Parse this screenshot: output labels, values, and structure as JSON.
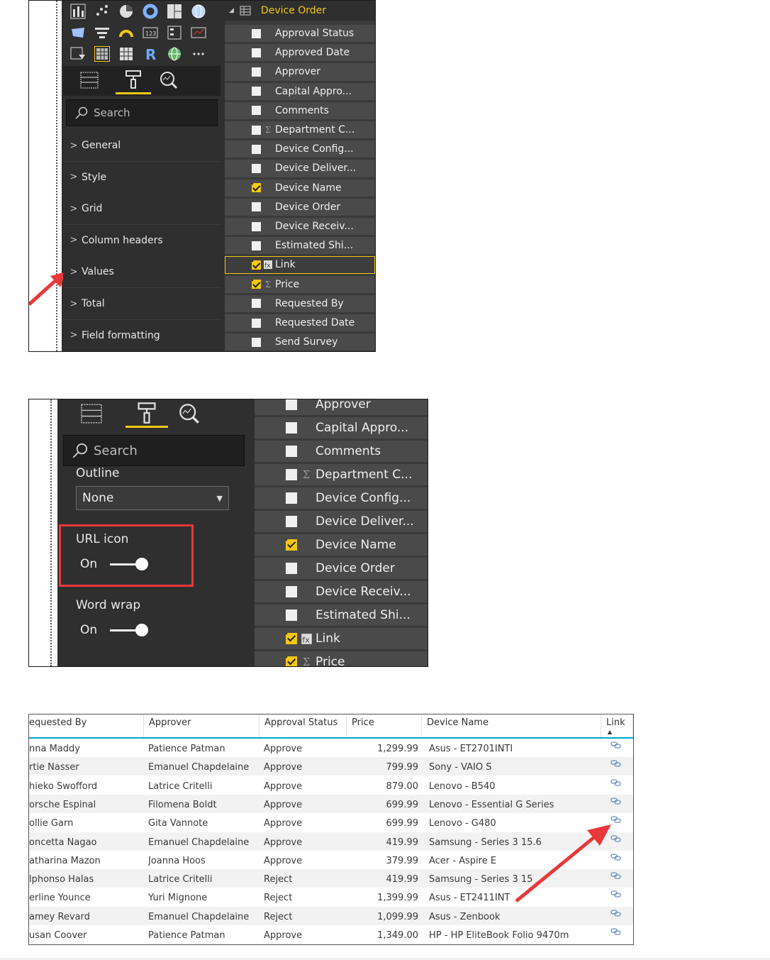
{
  "panel1": {
    "search_placeholder": "Search",
    "sections": [
      "General",
      "Style",
      "Grid",
      "Column headers",
      "Values",
      "Total",
      "Field formatting"
    ],
    "table_title": "Device Order",
    "fields": [
      {
        "label": "Approval Status",
        "checked": false,
        "icon": ""
      },
      {
        "label": "Approved Date",
        "checked": false,
        "icon": ""
      },
      {
        "label": "Approver",
        "checked": false,
        "icon": ""
      },
      {
        "label": "Capital Appro...",
        "checked": false,
        "icon": ""
      },
      {
        "label": "Comments",
        "checked": false,
        "icon": ""
      },
      {
        "label": "Department C...",
        "checked": false,
        "icon": "sigma-icon"
      },
      {
        "label": "Device Config...",
        "checked": false,
        "icon": ""
      },
      {
        "label": "Device Deliver...",
        "checked": false,
        "icon": ""
      },
      {
        "label": "Device Name",
        "checked": true,
        "icon": ""
      },
      {
        "label": "Device Order",
        "checked": false,
        "icon": ""
      },
      {
        "label": "Device Receiv...",
        "checked": false,
        "icon": ""
      },
      {
        "label": "Estimated Shi...",
        "checked": false,
        "icon": ""
      },
      {
        "label": "Link",
        "checked": true,
        "icon": "calculated-column-icon",
        "selected": true
      },
      {
        "label": "Price",
        "checked": true,
        "icon": "sigma-icon"
      },
      {
        "label": "Requested By",
        "checked": false,
        "icon": ""
      },
      {
        "label": "Requested Date",
        "checked": false,
        "icon": ""
      },
      {
        "label": "Send Survey",
        "checked": false,
        "icon": ""
      }
    ]
  },
  "panel2": {
    "search_placeholder": "Search",
    "outline_label": "Outline",
    "outline_value": "None",
    "url_icon_label": "URL icon",
    "url_icon_state": "On",
    "word_wrap_label": "Word wrap",
    "word_wrap_state": "On",
    "fields": [
      {
        "label": "Approver",
        "checked": false,
        "icon": ""
      },
      {
        "label": "Capital Appro...",
        "checked": false,
        "icon": ""
      },
      {
        "label": "Comments",
        "checked": false,
        "icon": ""
      },
      {
        "label": "Department C...",
        "checked": false,
        "icon": "sigma-icon"
      },
      {
        "label": "Device Config...",
        "checked": false,
        "icon": ""
      },
      {
        "label": "Device Deliver...",
        "checked": false,
        "icon": ""
      },
      {
        "label": "Device Name",
        "checked": true,
        "icon": ""
      },
      {
        "label": "Device Order",
        "checked": false,
        "icon": ""
      },
      {
        "label": "Device Receiv...",
        "checked": false,
        "icon": ""
      },
      {
        "label": "Estimated Shi...",
        "checked": false,
        "icon": ""
      },
      {
        "label": "Link",
        "checked": true,
        "icon": "calculated-column-icon"
      },
      {
        "label": "Price",
        "checked": true,
        "icon": "sigma-icon"
      }
    ]
  },
  "table": {
    "headers": [
      "equested By",
      "Approver",
      "Approval Status",
      "Price",
      "Device Name",
      "Link"
    ],
    "rows": [
      [
        "nna Maddy",
        "Patience Patman",
        "Approve",
        "1,299.99",
        "Asus - ET2701INTI"
      ],
      [
        "rtie Nasser",
        "Emanuel Chapdelaine",
        "Approve",
        "799.99",
        "Sony - VAIO S"
      ],
      [
        "hieko Swofford",
        "Latrice Critelli",
        "Approve",
        "879.00",
        "Lenovo - B540"
      ],
      [
        "orsche Espinal",
        "Filomena Boldt",
        "Approve",
        "699.99",
        "Lenovo - Essential G Series"
      ],
      [
        "ollie Garn",
        "Gita Vannote",
        "Approve",
        "699.99",
        "Lenovo - G480"
      ],
      [
        "oncetta Nagao",
        "Emanuel Chapdelaine",
        "Approve",
        "419.99",
        "Samsung - Series 3 15.6"
      ],
      [
        "atharina Mazon",
        "Joanna Hoos",
        "Approve",
        "379.99",
        "Acer - Aspire E"
      ],
      [
        "lphonso Halas",
        "Latrice Critelli",
        "Reject",
        "419.99",
        "Samsung - Series 3 15"
      ],
      [
        "erline Younce",
        "Yuri Mignone",
        "Reject",
        "1,399.99",
        "Asus - ET2411INT"
      ],
      [
        "amey Revard",
        "Emanuel Chapdelaine",
        "Reject",
        "1,099.99",
        "Asus - Zenbook"
      ],
      [
        "usan Coover",
        "Patience Patman",
        "Approve",
        "1,349.00",
        "HP - HP EliteBook Folio 9470m"
      ]
    ]
  },
  "colors": {
    "accent": "#f2c811",
    "highlight": "#e8383a",
    "arrow": "#e8383a",
    "table_header_rule": "#00a8c8"
  }
}
